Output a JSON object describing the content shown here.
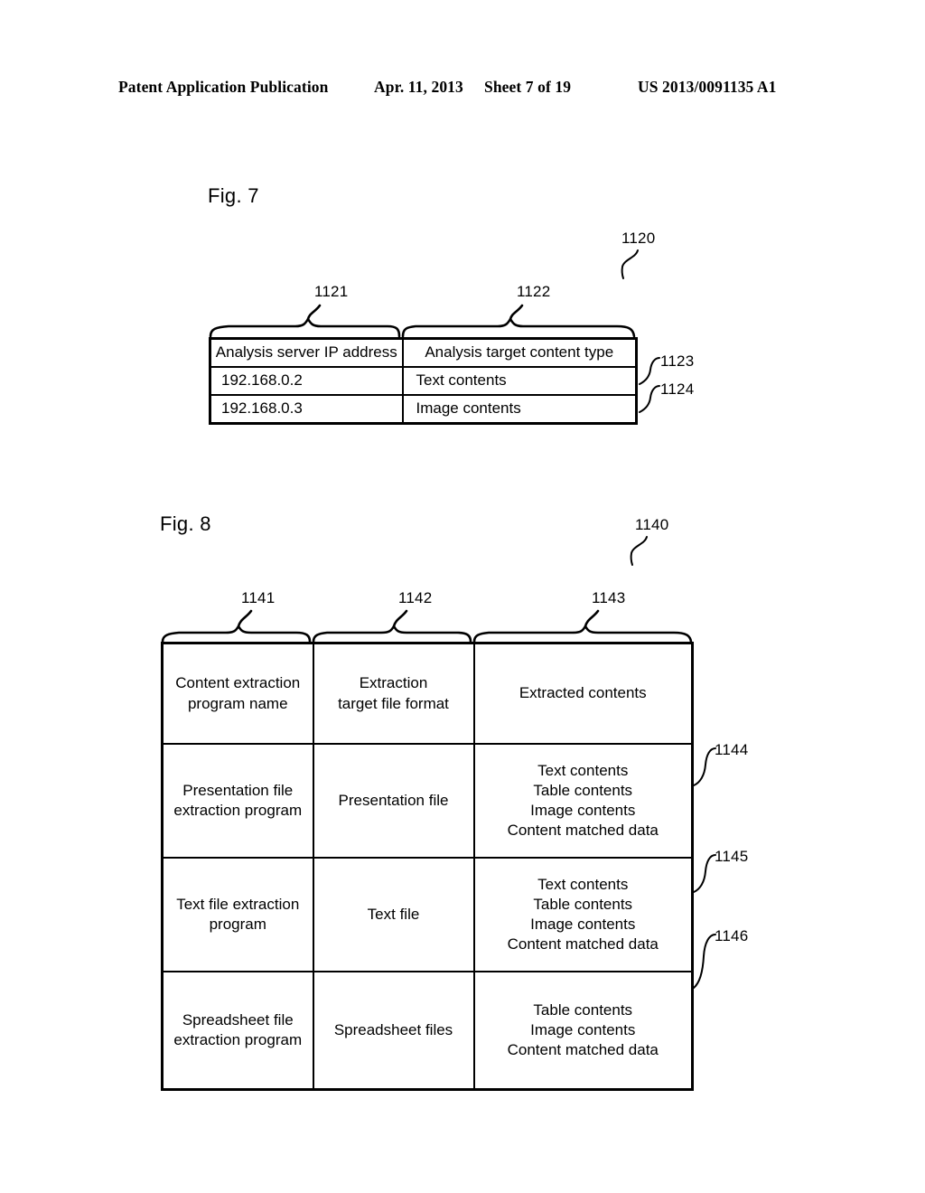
{
  "page_header": {
    "publication": "Patent Application Publication",
    "date": "Apr. 11, 2013",
    "sheet": "Sheet 7 of 19",
    "publication_number": "US 2013/0091135 A1"
  },
  "figures": [
    {
      "label": "Fig. 7",
      "table_ref": "1120",
      "column_refs": [
        "1121",
        "1122"
      ],
      "row_refs": [
        "1123",
        "1124"
      ],
      "headers": [
        "Analysis server IP address",
        "Analysis target content type"
      ],
      "rows": [
        [
          "192.168.0.2",
          "Text contents"
        ],
        [
          "192.168.0.3",
          "Image contents"
        ]
      ]
    },
    {
      "label": "Fig. 8",
      "table_ref": "1140",
      "column_refs": [
        "1141",
        "1142",
        "1143"
      ],
      "row_refs": [
        "1144",
        "1145",
        "1146"
      ],
      "headers": [
        "Content extraction\nprogram name",
        "Extraction\ntarget file format",
        "Extracted contents"
      ],
      "rows": [
        [
          "Presentation file\nextraction program",
          "Presentation file",
          "Text contents\nTable contents\nImage contents\nContent matched data"
        ],
        [
          "Text file extraction\nprogram",
          "Text file",
          "Text contents\nTable contents\nImage contents\nContent matched data"
        ],
        [
          "Spreadsheet file\nextraction program",
          "Spreadsheet files",
          "Table contents\nImage contents\nContent matched data"
        ]
      ]
    }
  ],
  "colors": {
    "ink": "#000000",
    "paper": "#ffffff"
  }
}
